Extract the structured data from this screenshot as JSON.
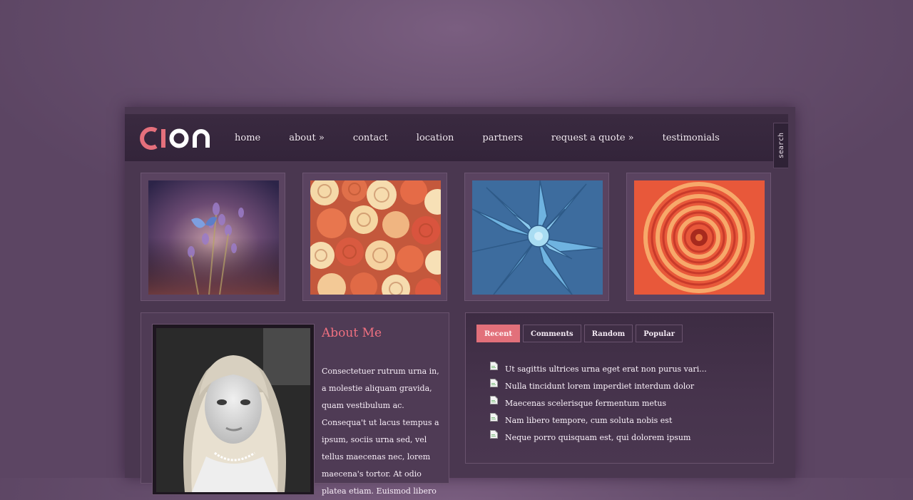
{
  "header": {
    "logo_text": "cion",
    "nav": [
      "home",
      "about »",
      "contact",
      "location",
      "partners",
      "request a quote »",
      "testimonials"
    ],
    "search_label": "search"
  },
  "gallery": [
    {
      "subject": "butterfly on lavender"
    },
    {
      "subject": "roses bouquet"
    },
    {
      "subject": "blue succulent"
    },
    {
      "subject": "orange dahlia"
    }
  ],
  "about": {
    "title": "About Me",
    "text": "Consectetuer rutrum urna in, a molestie aliquam gravida, quam vestibulum ac. Consequa't ut lacus tempus a ipsum, sociis urna sed, vel tellus maecenas nec, lorem maecena's tortor. At odio platea etiam. Euismod libero"
  },
  "tabs": [
    "Recent",
    "Comments",
    "Random",
    "Popular"
  ],
  "active_tab": "Recent",
  "recent_posts": [
    "Ut sagittis ultrices urna eget erat non purus vari...",
    "Nulla tincidunt lorem imperdiet interdum dolor",
    "Maecenas scelerisque fermentum metus",
    "Nam libero tempore, cum soluta nobis est",
    "Neque porro quisquam est, qui dolorem ipsum"
  ],
  "colors": {
    "accent": "#e2707a",
    "page_bg": "#4a3750",
    "header_bg": "#35263b"
  },
  "icons": {
    "post": "document-icon"
  }
}
